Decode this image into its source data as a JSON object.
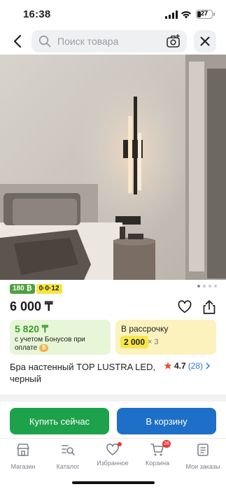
{
  "status_bar": {
    "time": "16:38",
    "battery": "27",
    "battery_level": 0.27
  },
  "header": {
    "search_placeholder": "Поиск товара"
  },
  "gallery": {
    "page_count": 4,
    "active_index": 0
  },
  "badges": {
    "bonus_badge": "180 ₿",
    "installment_badge": "0·0·12"
  },
  "product": {
    "price": "6 000 ₸",
    "title": "Бра настенный TOP LUSTRA LED, черный",
    "rating": "4.7",
    "reviews": "(28)"
  },
  "bonus_card": {
    "price": "5 820 ₸",
    "text": "с учетом Бонусов при оплате",
    "coin": "₿"
  },
  "installment_card": {
    "title": "В рассрочку",
    "amount": "2 000",
    "times": "× 3"
  },
  "actions": {
    "buy_label": "Купить сейчас",
    "cart_label": "В корзину"
  },
  "tabbar": {
    "items": [
      {
        "label": "Магазин"
      },
      {
        "label": "Каталог"
      },
      {
        "label": "Избранное"
      },
      {
        "label": "Корзина",
        "badge": "26"
      },
      {
        "label": "Мои заказы"
      }
    ]
  },
  "colors": {
    "accent_green": "#1da14a",
    "accent_blue": "#1d6fc7",
    "badge_red": "#e53935",
    "star": "#e5533d"
  },
  "icons": [
    "back-arrow-icon",
    "search-icon",
    "camera-icon",
    "close-icon",
    "heart-icon",
    "share-icon",
    "star-icon",
    "shop-icon",
    "catalog-icon",
    "favorites-icon",
    "cart-icon",
    "orders-icon"
  ]
}
